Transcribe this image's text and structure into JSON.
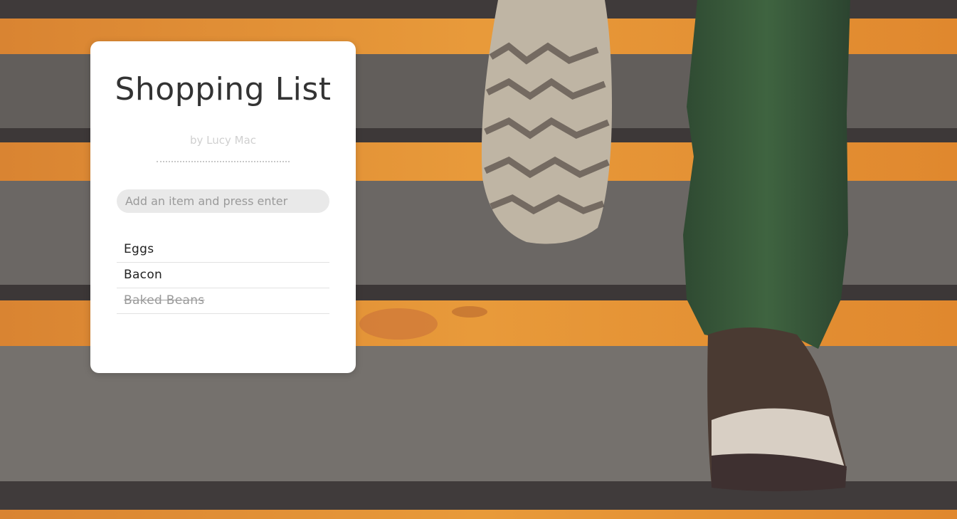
{
  "app": {
    "title": "Shopping List",
    "byline": "by Lucy Mac"
  },
  "input": {
    "placeholder": "Add an item and press enter",
    "value": ""
  },
  "items": [
    {
      "label": "Eggs",
      "done": false
    },
    {
      "label": "Bacon",
      "done": false
    },
    {
      "label": "Baked Beans",
      "done": true
    }
  ],
  "colors": {
    "card": "#ffffff",
    "title": "#333333",
    "byline": "#d0d0d0",
    "input_bg": "#e9e9e9",
    "done_text": "#9a9a9a",
    "stair_orange": "#e08a2c",
    "stair_gray": "#6e6a67"
  }
}
